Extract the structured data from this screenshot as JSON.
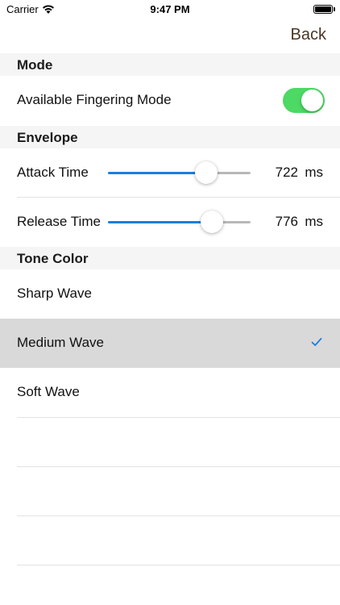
{
  "status_bar": {
    "carrier": "Carrier",
    "time": "9:47 PM"
  },
  "nav": {
    "back_label": "Back"
  },
  "sections": {
    "mode": {
      "title": "Mode",
      "fingering_label": "Available Fingering Mode",
      "fingering_enabled": true
    },
    "envelope": {
      "title": "Envelope",
      "attack": {
        "label": "Attack Time",
        "value": "722",
        "unit": "ms",
        "level": 0.69
      },
      "release": {
        "label": "Release Time",
        "value": "776",
        "unit": "ms",
        "level": 0.73
      }
    },
    "tone_color": {
      "title": "Tone Color",
      "options": [
        "Sharp Wave",
        "Medium Wave",
        "Soft Wave"
      ],
      "selected": "Medium Wave"
    }
  },
  "colors": {
    "toggle_on": "#4cd964",
    "slider_fill": "#1a7ee0",
    "checkmark": "#1a7ee0",
    "back_text": "#4a3626"
  }
}
